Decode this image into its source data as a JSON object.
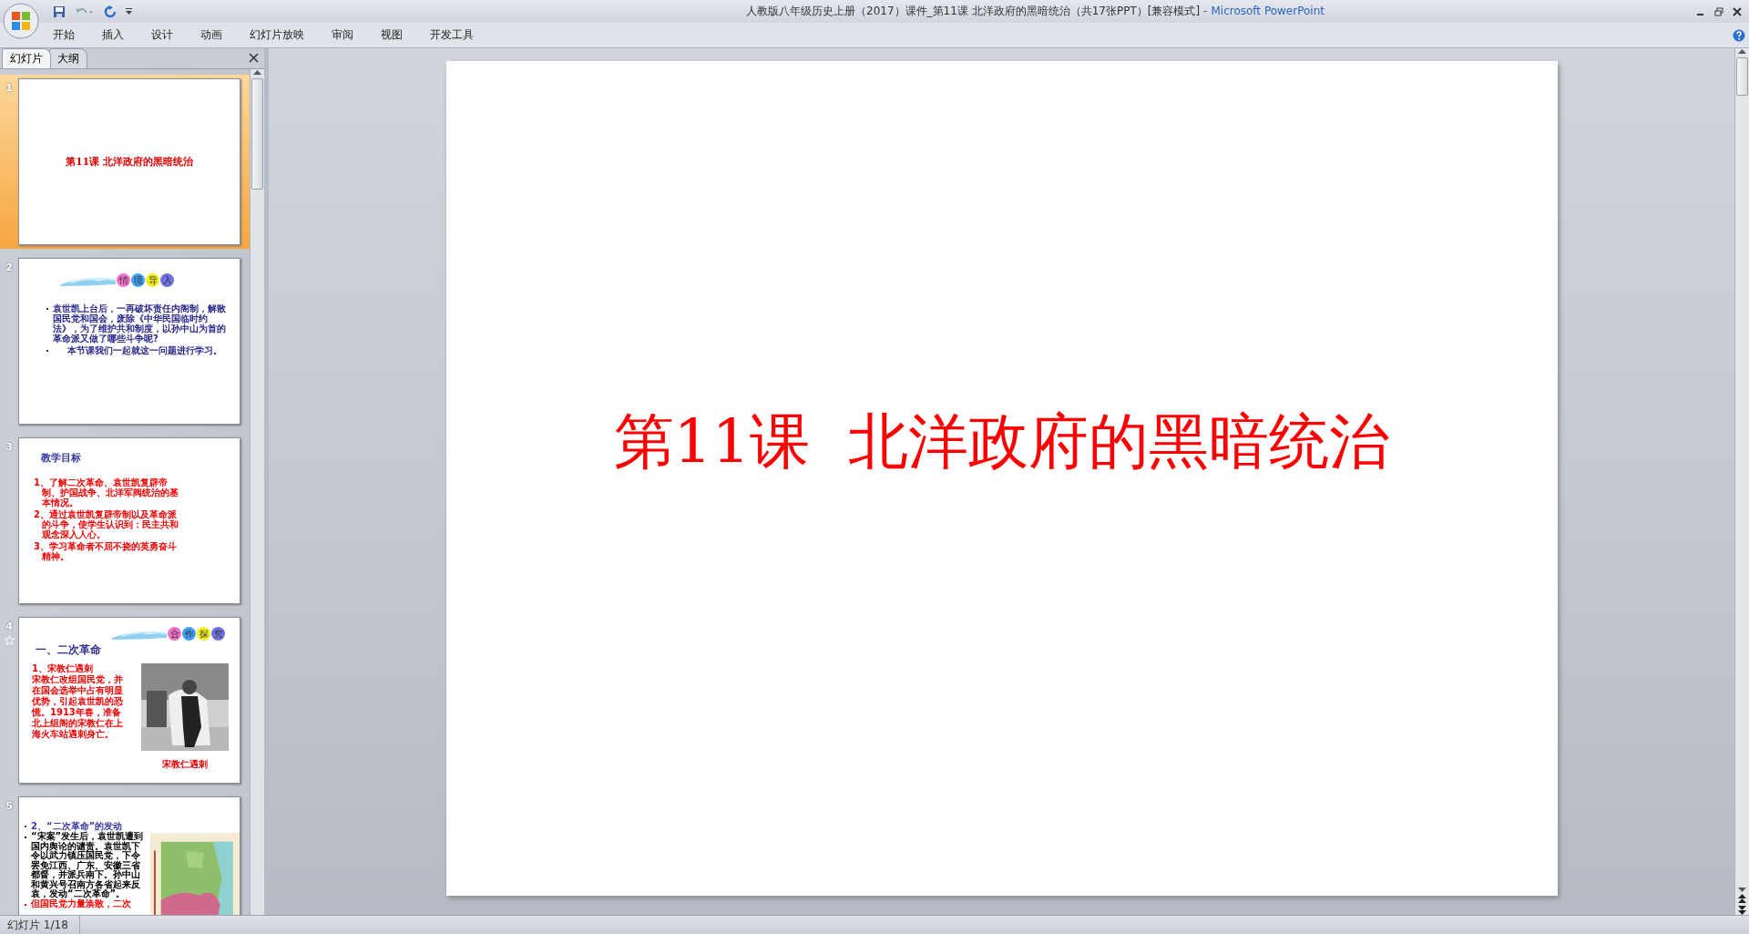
{
  "window": {
    "title": "人教版八年级历史上册（2017）课件_第11课 北洋政府的黑暗统治（共17张PPT）[兼容模式]",
    "separator": "-",
    "app": "Microsoft PowerPoint"
  },
  "ribbon_tabs": [
    "开始",
    "插入",
    "设计",
    "动画",
    "幻灯片放映",
    "审阅",
    "视图",
    "开发工具"
  ],
  "panel_tabs": [
    {
      "label": "幻灯片",
      "selected": true
    },
    {
      "label": "大纲",
      "selected": false
    }
  ],
  "slides": [
    {
      "number": "1",
      "selected": true,
      "animated": false,
      "kind": "title",
      "title": "第11课  北洋政府的黑暗统治"
    },
    {
      "number": "2",
      "selected": false,
      "animated": false,
      "kind": "bullets",
      "badge": [
        {
          "char": "情",
          "color": "#f070c8"
        },
        {
          "char": "境",
          "color": "#40a0f0"
        },
        {
          "char": "导",
          "color": "#f0f020"
        },
        {
          "char": "入",
          "color": "#7070e0"
        }
      ],
      "bullets": [
        "袁世凯上台后，一再破坏责任内阁制，解散国民党和国会，废除《中华民国临时约法》，为了维护共和制度，以孙中山为首的革命派又做了哪些斗争呢?",
        "本节课我们一起就这一问题进行学习。"
      ]
    },
    {
      "number": "3",
      "selected": false,
      "animated": false,
      "kind": "objectives",
      "heading": "教学目标",
      "items": [
        "1、了解二次革命、袁世凯复辟帝制、护国战争、北洋军阀统治的基本情况。",
        "2、通过袁世凯复辟帝制以及革命派的斗争，使学生认识到：民主共和观念深入人心。",
        "3、学习革命者不屈不挠的英勇奋斗精神。"
      ]
    },
    {
      "number": "4",
      "selected": false,
      "animated": true,
      "badge": [
        {
          "char": "合",
          "color": "#f070c8"
        },
        {
          "char": "作",
          "color": "#40a0f0"
        },
        {
          "char": "探",
          "color": "#f0f020"
        },
        {
          "char": "究",
          "color": "#7070e0"
        }
      ],
      "heading": "一、二次革命",
      "subheading": "1、宋教仁遇刺",
      "text": "宋教仁改组国民党，并在国会选举中占有明显优势，引起袁世凯的恐慌。1913年春，准备北上组阁的宋教仁在上海火车站遇刺身亡。",
      "caption": "宋教仁遇刺"
    },
    {
      "number": "5",
      "selected": false,
      "animated": false,
      "kind": "map",
      "heading": "2、“二次革命”的发动",
      "bullets": [
        {
          "text": "“宋案”发生后，袁世凯遭到国内舆论的谴责。袁世凯下令以武力镇压国民党，下令罢免江西、广东、安徽三省都督，并派兵南下。孙中山和黄兴号召南方各省起来反袁，发动“二次革命”。",
          "color": "#000000"
        },
        {
          "text": "但国民党力量涣散，二次",
          "color": "#ff0000"
        }
      ]
    }
  ],
  "editor": {
    "title": "第11课  北洋政府的黑暗统治"
  },
  "status_bar": {
    "slide_info": "幻灯片 1/18"
  }
}
